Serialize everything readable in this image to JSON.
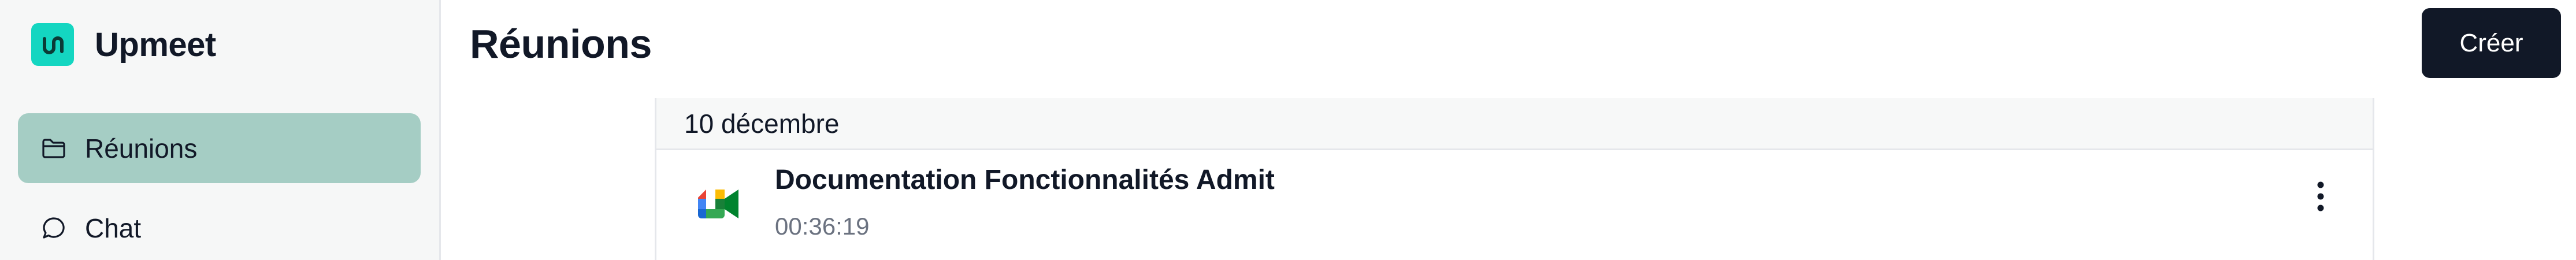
{
  "app": {
    "name": "Upmeet",
    "logo_icon": "upmeet-logo-icon",
    "accent": "#14d6c1"
  },
  "sidebar": {
    "items": [
      {
        "label": "Réunions",
        "icon": "folder-icon",
        "active": true,
        "active_bg": "#a5cdc4"
      },
      {
        "label": "Chat",
        "icon": "chat-bubble-icon",
        "active": false
      }
    ]
  },
  "header": {
    "title": "Réunions",
    "create_label": "Créer"
  },
  "meetings": {
    "groups": [
      {
        "date": "10 décembre",
        "items": [
          {
            "title": "Documentation Fonctionnalités Admit",
            "duration": "00:36:19",
            "source_icon": "google-meet-icon",
            "menu_icon": "more-vertical-icon"
          }
        ]
      }
    ]
  }
}
